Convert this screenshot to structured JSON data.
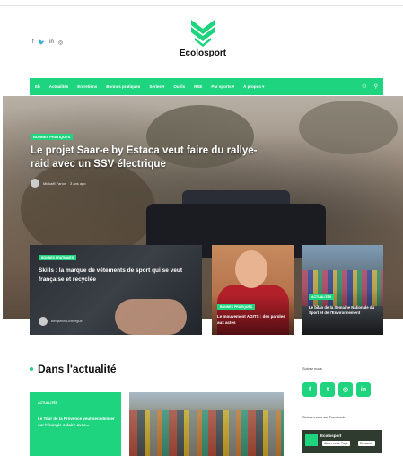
{
  "header": {
    "social_icons": [
      "facebook-icon",
      "twitter-icon",
      "linkedin-icon",
      "instagram-icon"
    ],
    "social_glyphs": [
      "f",
      "🐦",
      "in",
      "◎"
    ],
    "logo_text": "Ecolosport"
  },
  "nav": {
    "items": [
      "Eb",
      "Actualités",
      "Entretiens",
      "Bonnes pratiques",
      "Séries ▾",
      "Outils",
      "RSE",
      "Par sports ▾",
      "À propos ▾"
    ],
    "search_glyph": "⚲",
    "user_glyph": "⚇"
  },
  "hero": {
    "tag": "Bonnes pratiques",
    "title": "Le projet Saar-e by Estaca veut faire du rallye-raid avec un SSV électrique",
    "author": "Mickaël Fanon",
    "time": "3 ans ago"
  },
  "cards": [
    {
      "tag": "Bonnes pratiques",
      "title": "Skills : la marque de vêtements de sport qui se veut française et recyclée",
      "author": "Benjamin Domergue"
    },
    {
      "tag": "Bonnes pratiques",
      "title": "Le mouvement AGITS : des paroles aux actes"
    },
    {
      "tag": "Actualités",
      "title": "Le bilan de la Semaine Nationale du Sport et de l'Environnement"
    }
  ],
  "actualite": {
    "section_title": "Dans l'actualité",
    "card_tag": "Actualités",
    "card_title": "Le Tour de la Provence veut sensibiliser sur l'énergie solaire avec..."
  },
  "sidebar": {
    "follow_label": "Suivez nous",
    "social_buttons": [
      "f",
      "t",
      "◎",
      "in"
    ],
    "facebook_label": "Suivez-nous sur Facebook",
    "fb_page_name": "Ecolosport",
    "fb_button1": "Aimer cette Page",
    "fb_button2": "En savoir"
  },
  "colors": {
    "accent": "#1ed47f",
    "text": "#111111"
  }
}
